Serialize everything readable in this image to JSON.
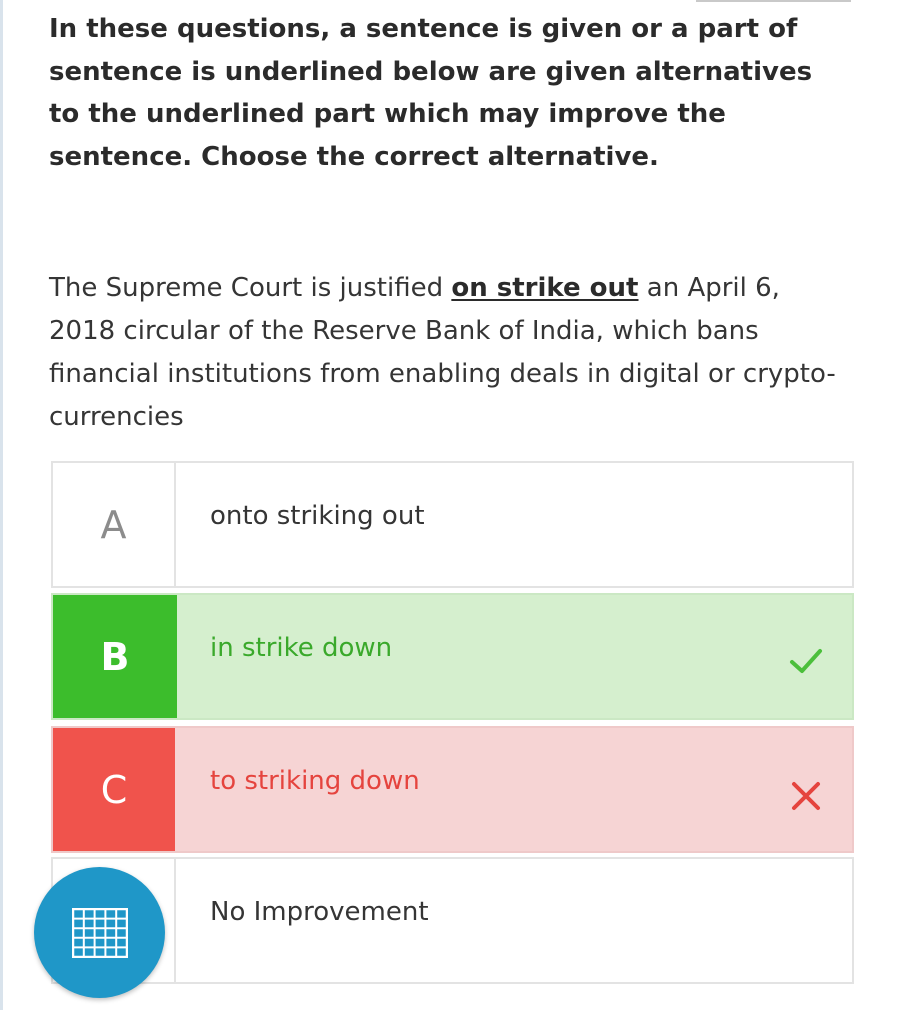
{
  "instructions": "In these questions, a sentence is given or a part of sentence is underlined below are given alternatives to the underlined part which may improve the sentence. Choose the correct alternative.",
  "question": {
    "before": "The Supreme Court is justified ",
    "underlined": "on strike out",
    "after": " an April 6, 2018 circular of the Reserve Bank of India, which bans financial institutions from enabling deals in digital or crypto-currencies"
  },
  "options": [
    {
      "letter": "A",
      "text": "onto striking out",
      "state": "neutral"
    },
    {
      "letter": "B",
      "text": "in strike down",
      "state": "correct",
      "icon": "checkmark-icon"
    },
    {
      "letter": "C",
      "text": "to striking down",
      "state": "wrong",
      "icon": "cross-icon"
    },
    {
      "letter": "D",
      "text": "No Improvement",
      "state": "neutral"
    }
  ],
  "fab": {
    "icon": "grid-icon"
  },
  "colors": {
    "correct": "#3cbd2c",
    "correct_bg": "#d5efce",
    "wrong": "#f0534c",
    "wrong_bg": "#f6d4d4",
    "fab": "#1f97c8"
  }
}
